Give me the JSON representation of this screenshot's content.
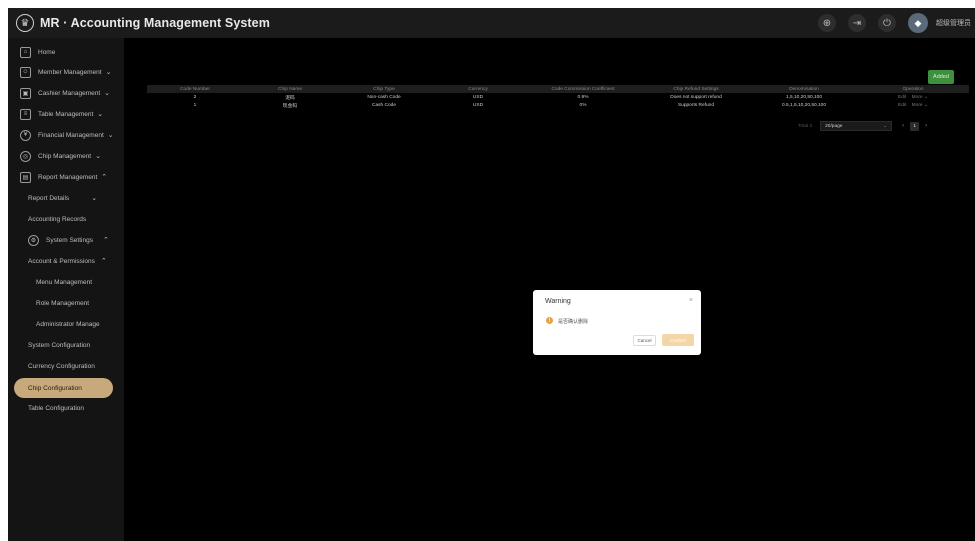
{
  "app": {
    "title": "MR · Accounting Management System",
    "logo_glyph": "♛",
    "user_name": "超级管理员"
  },
  "topbar": {
    "icons": [
      {
        "name": "globe-icon",
        "glyph": "⊕"
      },
      {
        "name": "logout-icon",
        "glyph": "⇥"
      },
      {
        "name": "power-icon",
        "glyph": "⏻"
      }
    ]
  },
  "sidebar": {
    "items": [
      {
        "label": "Home",
        "icon": "home-icon",
        "glyph": "⌂"
      },
      {
        "label": "Member Management",
        "icon": "members-icon",
        "glyph": "☺",
        "chevron": "⌄"
      },
      {
        "label": "Cashier Management",
        "icon": "cashier-icon",
        "glyph": "▣",
        "chevron": "⌄"
      },
      {
        "label": "Table Management",
        "icon": "table-icon",
        "glyph": "≡",
        "chevron": "⌄"
      },
      {
        "label": "Financial Management",
        "icon": "finance-icon",
        "glyph": "¥",
        "chevron": "⌄"
      },
      {
        "label": "Chip Management",
        "icon": "chip-icon",
        "glyph": "◎",
        "chevron": "⌄"
      },
      {
        "label": "Report Management",
        "icon": "report-icon",
        "glyph": "▤",
        "chevron": "⌃"
      },
      {
        "label": "Report Details",
        "chevron": "⌄"
      },
      {
        "label": "Accounting Records"
      },
      {
        "label": "System Settings",
        "icon": "settings-icon",
        "glyph": "⚙",
        "chevron": "⌃"
      },
      {
        "label": "Account & Permissions",
        "chevron": "⌃"
      },
      {
        "label": "Menu Management"
      },
      {
        "label": "Role Management"
      },
      {
        "label": "Administrator Manage"
      },
      {
        "label": "System Configuration"
      },
      {
        "label": "Currency Configuration"
      },
      {
        "label": "Chip Configuration"
      },
      {
        "label": "Table Configuration"
      }
    ]
  },
  "toolbar": {
    "add_label": "Added"
  },
  "table": {
    "columns": [
      "Code Number",
      "Chip Name",
      "Chip Type",
      "Currency",
      "Code Commission Coefficient",
      "Chip Refund Settings",
      "Denomination",
      "Operation"
    ],
    "rows": [
      {
        "code": "2",
        "name": "泥码",
        "type": "Non-cash Code",
        "currency": "USD",
        "coef": "0.9%",
        "refund": "Does not support refund",
        "denom": "1,5,10,20,50,100",
        "edit": "Edit",
        "more": "More"
      },
      {
        "code": "1",
        "name": "现金码",
        "type": "Cash Code",
        "currency": "USD",
        "coef": "0%",
        "refund": "Supports Refund",
        "denom": "0.5,1,5,10,20,50,100",
        "edit": "Edit",
        "more": "More"
      }
    ]
  },
  "pagination": {
    "total": "Total 2",
    "page_size": "20/page",
    "prev": "‹",
    "next": "›",
    "current": "1"
  },
  "dialog": {
    "title": "Warning",
    "close": "×",
    "icon": "!",
    "message": "是否确认删除",
    "cancel": "Cancel",
    "confirm": "Confirm"
  },
  "colors": {
    "active_item": "#c7a97c",
    "add_button": "#3e8f3e",
    "confirm_button": "#f3d5a7",
    "warning": "#e6a23c"
  }
}
